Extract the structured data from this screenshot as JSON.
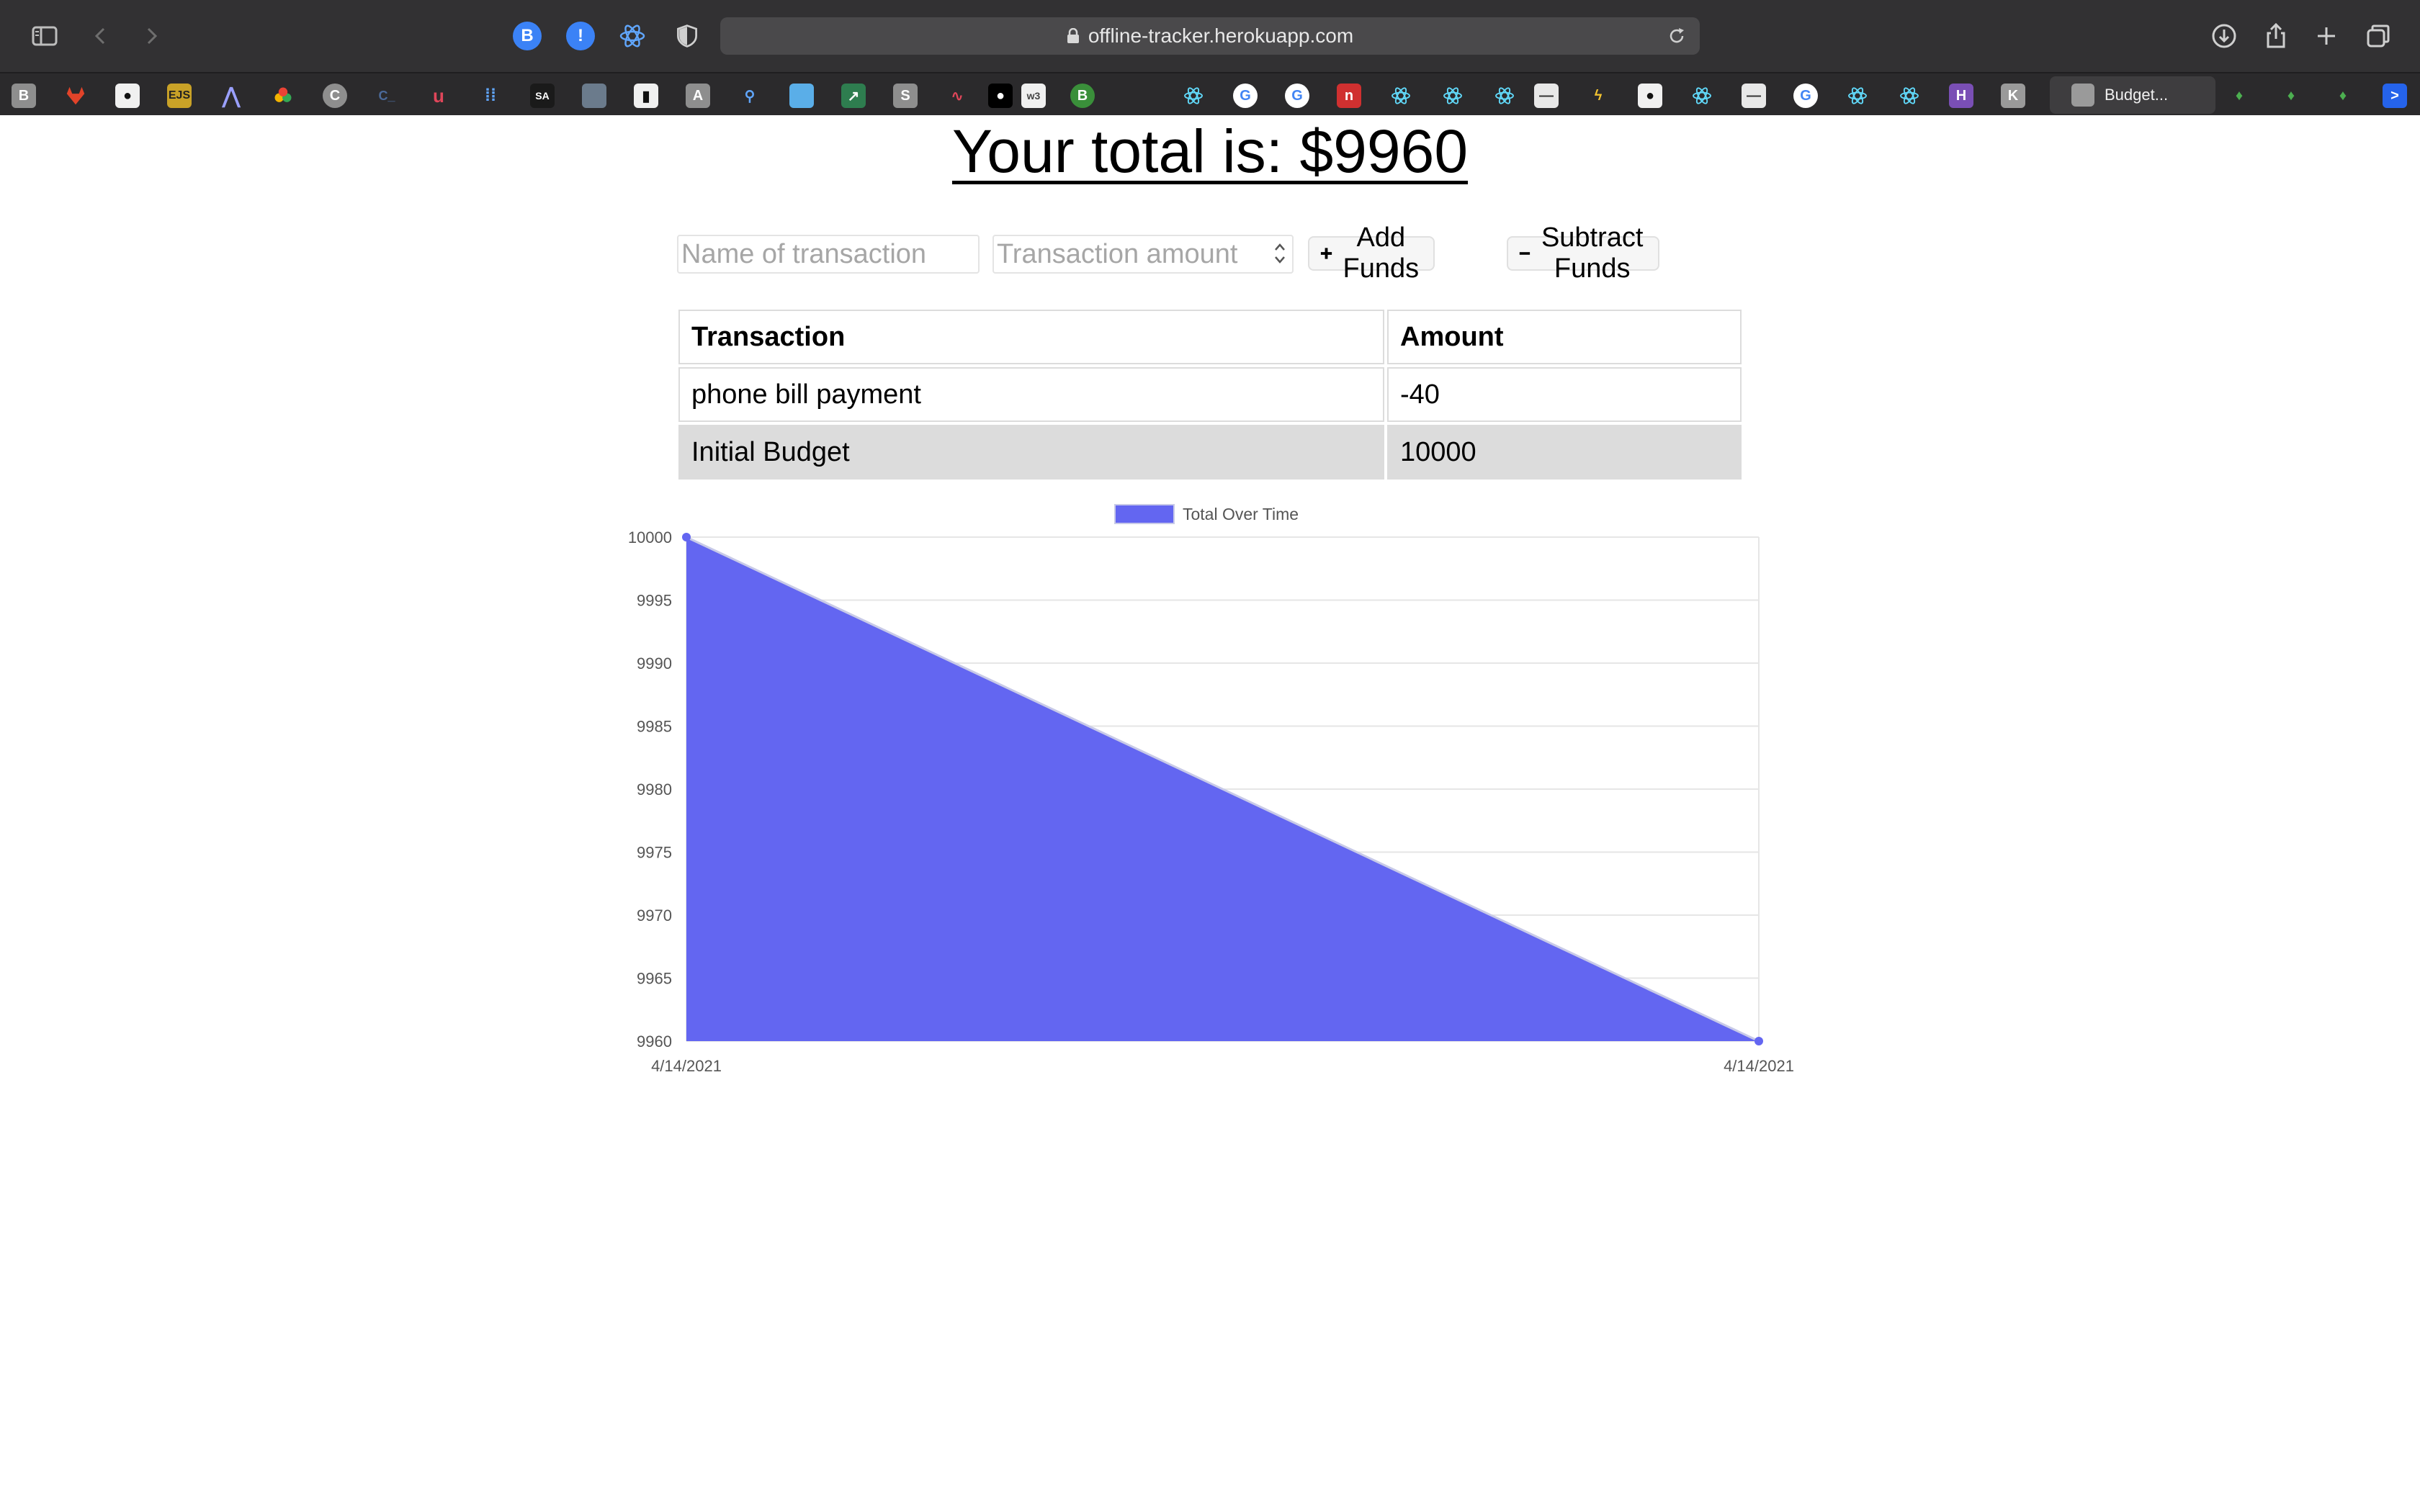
{
  "browser": {
    "url": "offline-tracker.herokuapp.com",
    "active_tab_title": "Budget...",
    "extension_badge_label": "B"
  },
  "app": {
    "total_heading": "Your total is: $9960",
    "form": {
      "name_placeholder": "Name of transaction",
      "amount_placeholder": "Transaction amount",
      "add_button_label": "Add Funds",
      "subtract_button_label": "Subtract Funds"
    },
    "table": {
      "headers": [
        "Transaction",
        "Amount"
      ],
      "rows": [
        {
          "name": "phone bill payment",
          "amount": "-40"
        },
        {
          "name": "Initial Budget",
          "amount": "10000"
        }
      ]
    },
    "colors": {
      "area_fill": "#6366f1",
      "area_stroke": "#c8cae8",
      "row_shade": "#dcdcdc"
    }
  },
  "chart_data": {
    "type": "area",
    "x": [
      "4/14/2021",
      "4/14/2021"
    ],
    "series": [
      {
        "name": "Total Over Time",
        "values": [
          10000,
          9960
        ]
      }
    ],
    "ylim": [
      9960,
      10000
    ],
    "yticks": [
      10000,
      9995,
      9990,
      9985,
      9980,
      9975,
      9970,
      9965,
      9960
    ],
    "legend_position": "top-center",
    "grid": true
  }
}
